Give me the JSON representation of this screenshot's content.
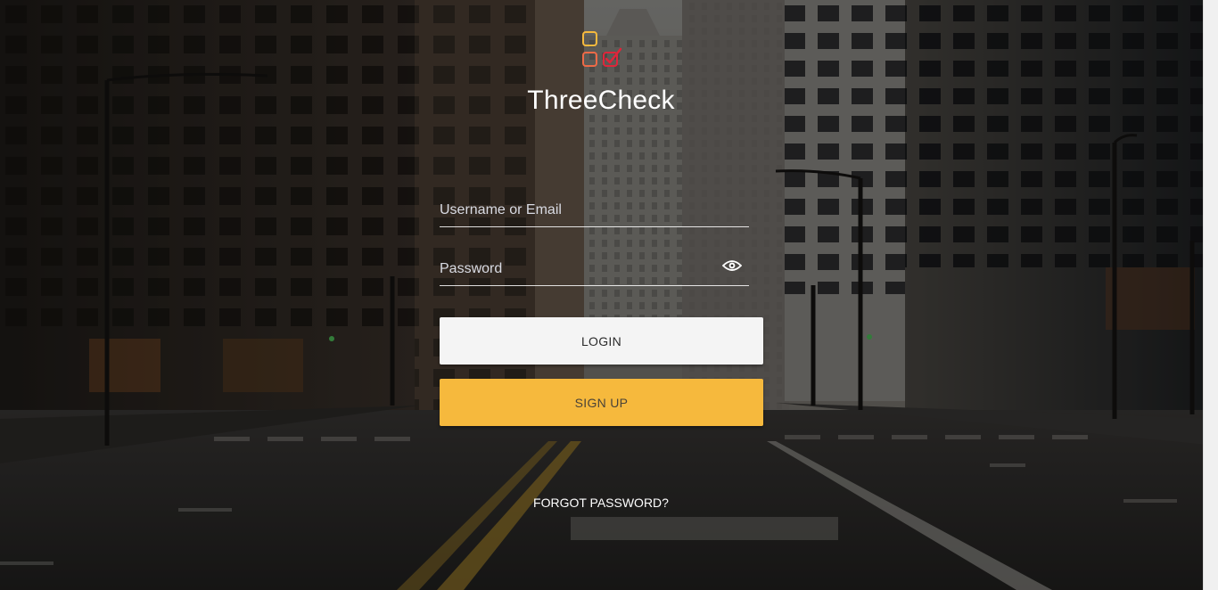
{
  "app": {
    "title": "ThreeCheck"
  },
  "login_form": {
    "username_placeholder": "Username or Email",
    "password_placeholder": "Password",
    "login_label": "LOGIN",
    "signup_label": "SIGN UP",
    "forgot_label": "FORGOT PASSWORD?"
  },
  "icons": {
    "logo": "three-check-logo-icon",
    "password_toggle": "eye-icon"
  },
  "colors": {
    "logo_box_top": "#f6b93d",
    "logo_box_left": "#ee6a47",
    "logo_box_checked": "#e0253a",
    "signup_button": "#f6b93d",
    "login_button": "#f4f4f4"
  }
}
